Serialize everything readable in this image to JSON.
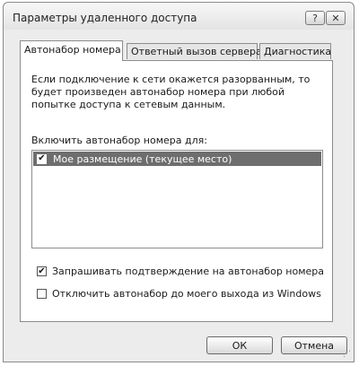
{
  "window": {
    "title": "Параметры удаленного доступа",
    "help_label": "?",
    "close_label": "✕"
  },
  "tabs": [
    {
      "label": "Автонабор номера",
      "active": true
    },
    {
      "label": "Ответный вызов сервера",
      "active": false
    },
    {
      "label": "Диагностика",
      "active": false
    }
  ],
  "autodial": {
    "description": "Если подключение к сети окажется разорванным, то будет произведен автонабор номера при любой попытке доступа к сетевым данным.",
    "include_label": "Включить автонабор номера для:",
    "locations": [
      {
        "label": "Мое размещение (текущее место)",
        "checked": true,
        "selected": true
      }
    ],
    "confirm_label": "Запрашивать подтверждение на автонабор номера",
    "confirm_checked": true,
    "disable_label": "Отключить автонабор до моего выхода из Windows",
    "disable_checked": false
  },
  "buttons": {
    "ok": "ОК",
    "cancel": "Отмена"
  }
}
